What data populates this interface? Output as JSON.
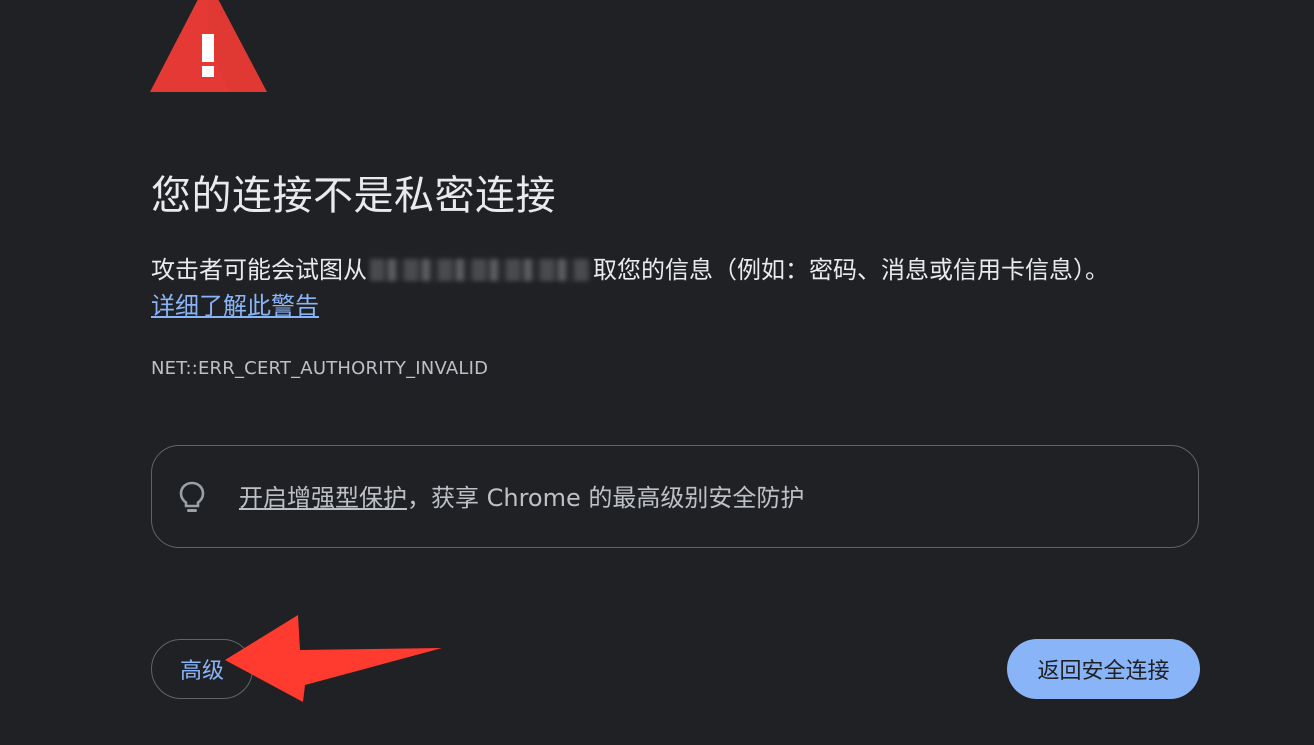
{
  "page": {
    "icon": "warning-triangle-icon",
    "title": "您的连接不是私密连接",
    "description_before": "攻击者可能会试图从",
    "description_after": "取您的信息（例如：密码、消息或信用卡信息）。",
    "learn_more_link": "详细了解此警告",
    "error_code": "NET::ERR_CERT_AUTHORITY_INVALID",
    "enhanced_protection": {
      "icon": "lightbulb-icon",
      "link_text": "开启增强型保护",
      "rest_text": "，获享 Chrome 的最高级别安全防护"
    },
    "advanced_button_label": "高级",
    "back_button_label": "返回安全连接",
    "annotation": {
      "icon": "red-arrow-icon",
      "color": "#ff3b30"
    }
  },
  "colors": {
    "background": "#202124",
    "accent": "#8ab4f8",
    "warning": "#e53935",
    "text": "#e8eaed",
    "muted_text": "#bdc1c6"
  }
}
